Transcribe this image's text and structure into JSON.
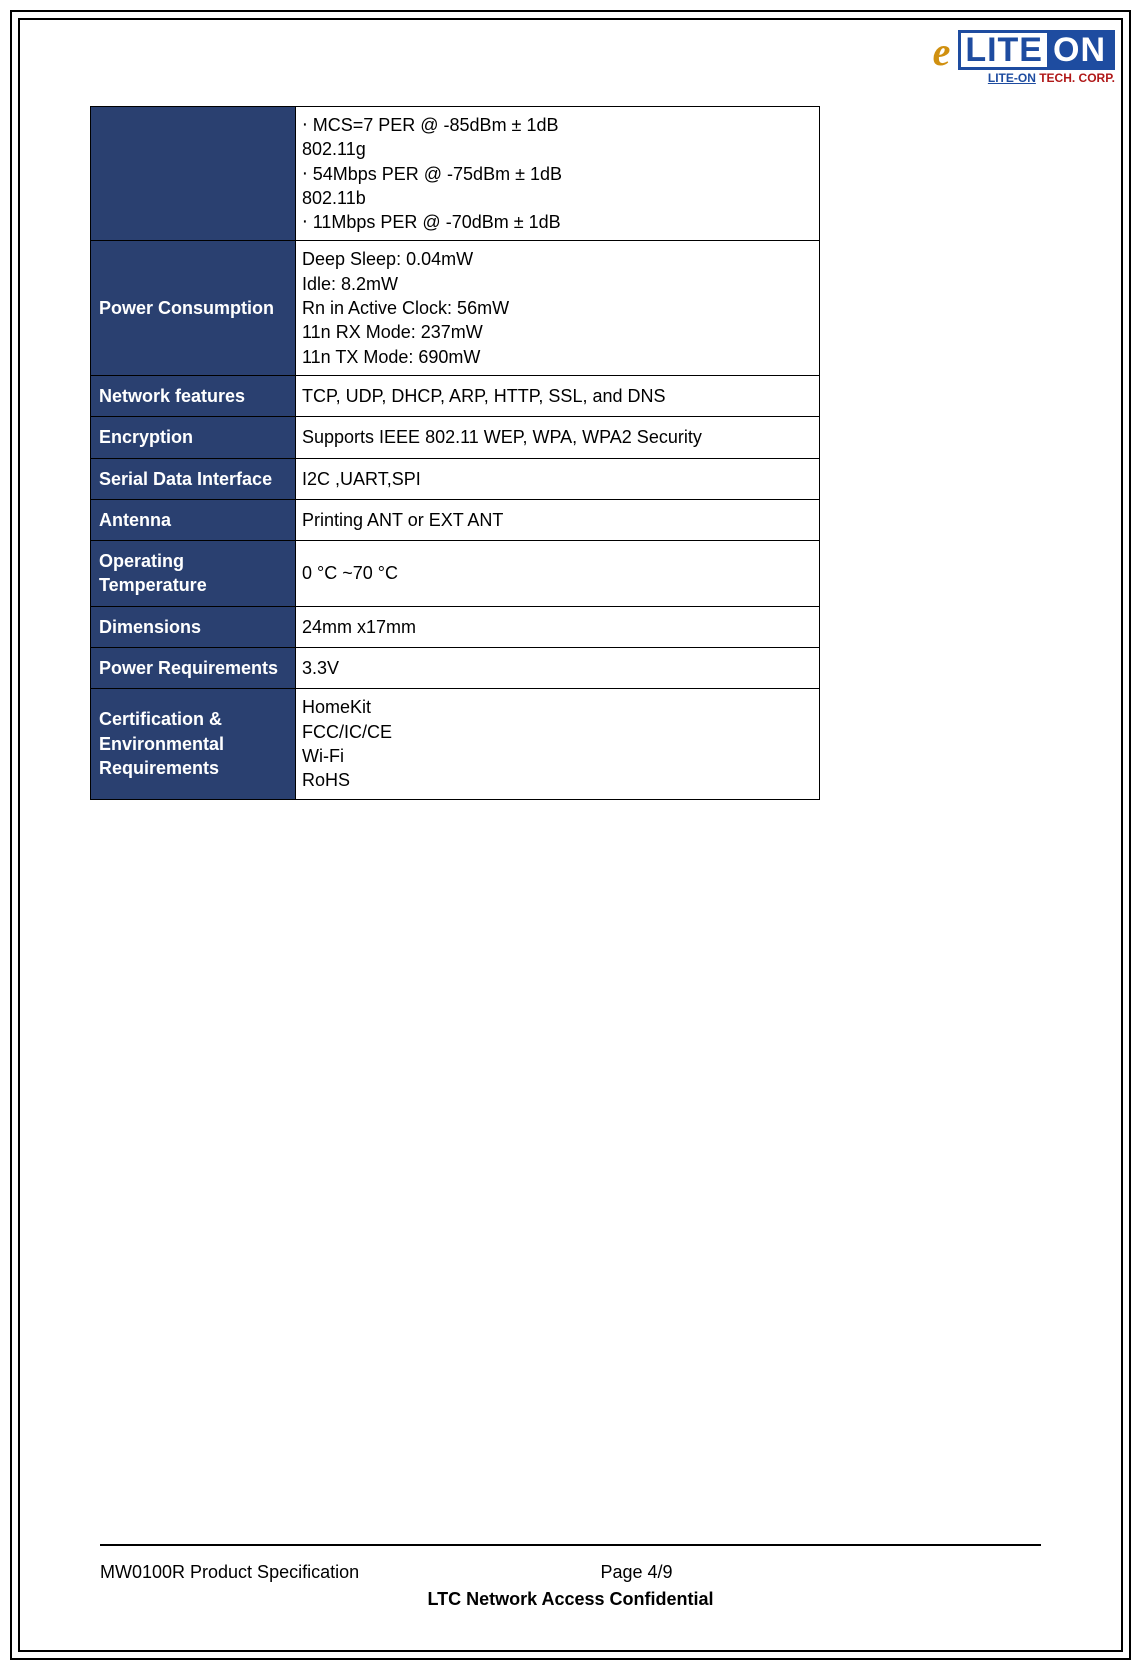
{
  "logo": {
    "brand_left": "LITE",
    "brand_right": "ON",
    "subtitle_brand": "LITE-ON",
    "subtitle_corp": " TECH. CORP."
  },
  "table": {
    "rows": [
      {
        "label": "",
        "value": "‧    MCS=7 PER @ -85dBm ± 1dB\n802.11g\n‧    54Mbps PER @ -75dBm ± 1dB\n802.11b\n‧    11Mbps PER @ -70dBm ± 1dB"
      },
      {
        "label": "Power Consumption",
        "value": "Deep Sleep: 0.04mW\nIdle: 8.2mW\nRn in Active Clock: 56mW\n11n RX Mode: 237mW\n11n TX Mode: 690mW"
      },
      {
        "label": "Network features",
        "value": "TCP, UDP, DHCP, ARP, HTTP, SSL, and DNS"
      },
      {
        "label": "Encryption",
        "value": "Supports IEEE 802.11 WEP, WPA, WPA2 Security"
      },
      {
        "label": "Serial Data Interface",
        "value": "I2C ,UART,SPI"
      },
      {
        "label": "Antenna",
        "value": "Printing ANT or EXT ANT"
      },
      {
        "label": "Operating Temperature",
        "value": "0 °C ~70 °C"
      },
      {
        "label": "Dimensions",
        "value": "24mm x17mm"
      },
      {
        "label": "Power Requirements",
        "value": "3.3V"
      },
      {
        "label": "Certification & Environmental Requirements",
        "value": "HomeKit\nFCC/IC/CE\nWi-Fi\nRoHS"
      }
    ]
  },
  "footer": {
    "left": "MW0100R Product Specification",
    "page": "Page 4/9",
    "confidential": "LTC Network Access Confidential"
  }
}
